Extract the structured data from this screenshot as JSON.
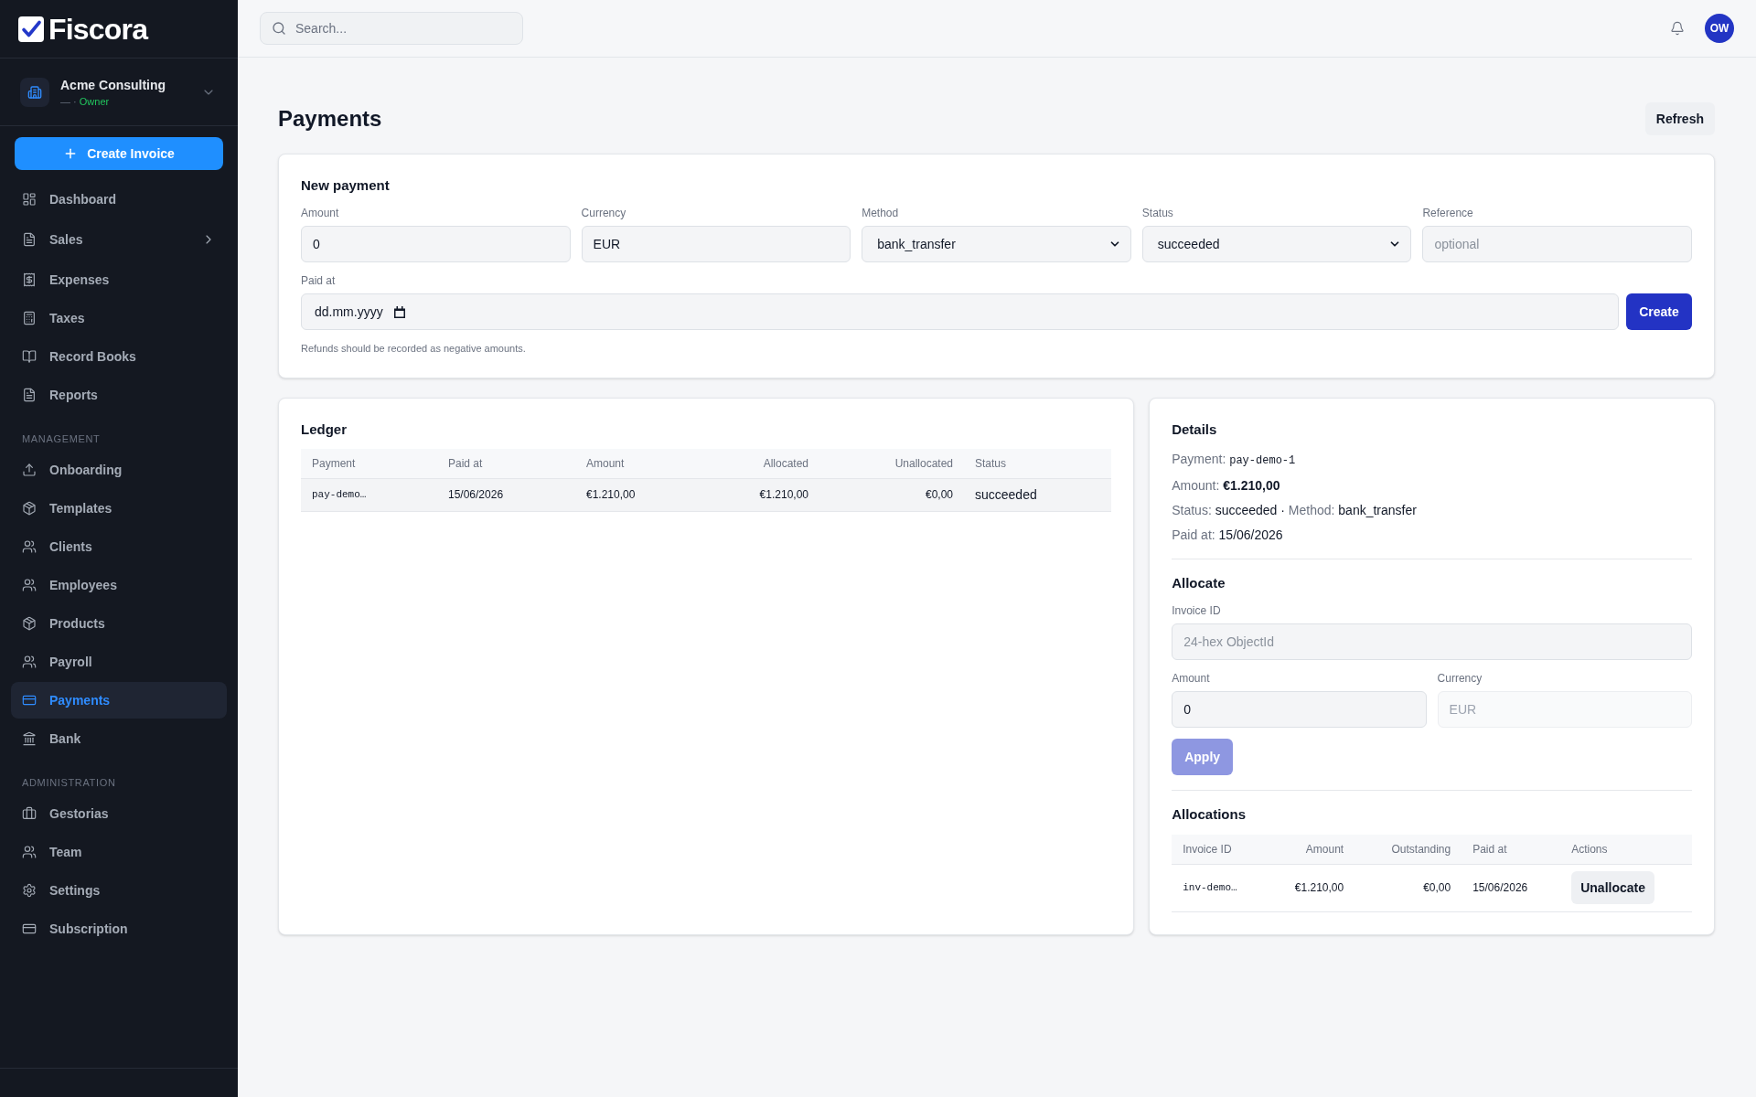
{
  "sidebar": {
    "logo": "Fiscora",
    "org": {
      "name": "Acme Consulting",
      "meta": "— ·",
      "role": "Owner"
    },
    "create_button": "Create Invoice",
    "sections": [
      {
        "items": [
          {
            "label": "Dashboard",
            "selected": false,
            "kind": "link"
          },
          {
            "label": "Sales",
            "selected": false,
            "kind": "group",
            "expanded": false
          },
          {
            "label": "Expenses",
            "selected": false,
            "kind": "link"
          },
          {
            "label": "Taxes",
            "selected": false,
            "kind": "link"
          },
          {
            "label": "Record Books",
            "selected": false,
            "kind": "link"
          },
          {
            "label": "Reports",
            "selected": false,
            "kind": "link"
          }
        ]
      },
      {
        "heading": "MANAGEMENT",
        "items": [
          {
            "label": "Onboarding",
            "selected": false,
            "kind": "link"
          },
          {
            "label": "Templates",
            "selected": false,
            "kind": "link"
          },
          {
            "label": "Clients",
            "selected": false,
            "kind": "link"
          },
          {
            "label": "Employees",
            "selected": false,
            "kind": "link"
          },
          {
            "label": "Products",
            "selected": false,
            "kind": "link"
          },
          {
            "label": "Payroll",
            "selected": false,
            "kind": "link"
          },
          {
            "label": "Payments",
            "selected": true,
            "kind": "link"
          },
          {
            "label": "Bank",
            "selected": false,
            "kind": "link"
          }
        ]
      },
      {
        "heading": "ADMINISTRATION",
        "items": [
          {
            "label": "Gestorias",
            "selected": false,
            "kind": "link"
          },
          {
            "label": "Team",
            "selected": false,
            "kind": "link"
          },
          {
            "label": "Settings",
            "selected": false,
            "kind": "link"
          },
          {
            "label": "Subscription",
            "selected": false,
            "kind": "link"
          }
        ]
      }
    ]
  },
  "topbar": {
    "search": {
      "placeholder": "Search..."
    },
    "avatar": "OW"
  },
  "page": {
    "title": "Payments",
    "refresh_button": "Refresh"
  },
  "new_payment": {
    "title": "New payment",
    "fields": [
      {
        "label": "Amount",
        "kind": "input",
        "value": "0"
      },
      {
        "label": "Currency",
        "kind": "input",
        "value": "EUR"
      },
      {
        "label": "Method",
        "kind": "select",
        "value": "bank_transfer"
      },
      {
        "label": "Status",
        "kind": "select",
        "value": "succeeded"
      },
      {
        "label": "Reference",
        "kind": "input",
        "placeholder": "optional"
      }
    ],
    "paid_at": {
      "label": "Paid at",
      "placeholder": "dd.mm.yyyy"
    },
    "create_button": "Create",
    "hint": "Refunds should be recorded as negative amounts."
  },
  "ledger": {
    "title": "Ledger",
    "columns": [
      "Payment",
      "Paid at",
      "Amount",
      "Allocated",
      "Unallocated",
      "Status"
    ],
    "rows": [
      {
        "selected": true,
        "cells": [
          "pay-demo…",
          "15/06/2026",
          "€1.210,00",
          "€1.210,00",
          "€0,00",
          "succeeded"
        ]
      }
    ]
  },
  "details": {
    "title": "Details",
    "lines": [
      [
        {
          "kind": "label",
          "text": "Payment:"
        },
        {
          "kind": "code",
          "text": "pay-demo-1"
        }
      ],
      [
        {
          "kind": "label",
          "text": "Amount:"
        },
        {
          "kind": "strong",
          "text": "€1.210,00"
        }
      ],
      [
        {
          "kind": "label",
          "text": "Status:"
        },
        {
          "kind": "text",
          "text": "succeeded"
        },
        {
          "kind": "text",
          "text": "·"
        },
        {
          "kind": "label",
          "text": "Method:"
        },
        {
          "kind": "text",
          "text": "bank_transfer"
        }
      ],
      [
        {
          "kind": "label",
          "text": "Paid at:"
        },
        {
          "kind": "text",
          "text": "15/06/2026"
        }
      ]
    ]
  },
  "allocate": {
    "title": "Allocate",
    "invoice_id": {
      "label": "Invoice ID",
      "placeholder": "24-hex ObjectId"
    },
    "amount": {
      "label": "Amount",
      "value": "0"
    },
    "currency": {
      "label": "Currency",
      "value": "EUR",
      "disabled": true
    },
    "apply_button": {
      "label": "Apply",
      "disabled": true
    }
  },
  "allocations": {
    "title": "Allocations",
    "columns": [
      "Invoice ID",
      "Amount",
      "Outstanding",
      "Paid at",
      "Actions"
    ],
    "rows": [
      {
        "cells": [
          "inv-demo…",
          "€1.210,00",
          "€0,00",
          "15/06/2026"
        ],
        "action": "Unallocate"
      }
    ]
  }
}
